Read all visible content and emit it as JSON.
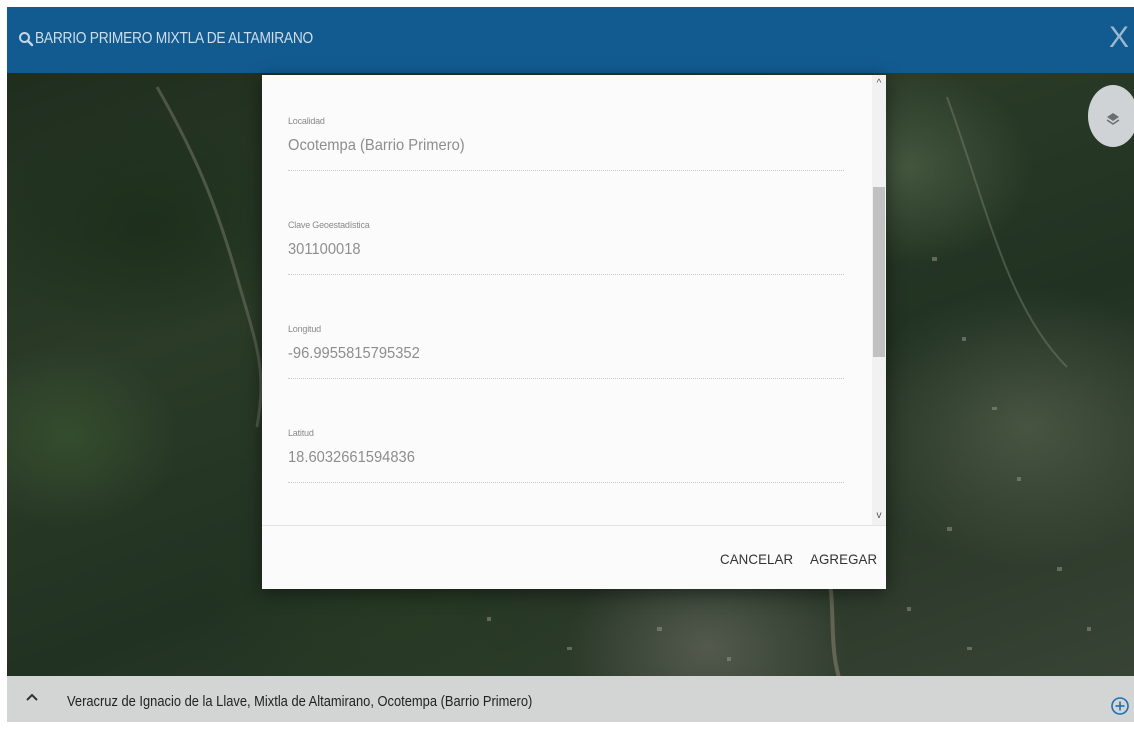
{
  "search": {
    "query": "BARRIO PRIMERO MIXTLA DE ALTAMIRANO",
    "close_label": "X"
  },
  "icons": {
    "search": "search-icon",
    "close": "close-icon",
    "layers": "layers-icon",
    "scroll_up": "chevron-up-icon",
    "scroll_down": "chevron-down-icon",
    "expand": "chevron-up-icon",
    "add_location": "add-circle-icon"
  },
  "dialog": {
    "fields": [
      {
        "label": "Localidad",
        "value": "Ocotempa (Barrio Primero)"
      },
      {
        "label": "Clave Geoestadística",
        "value": "301100018"
      },
      {
        "label": "Longitud",
        "value": "-96.9955815795352"
      },
      {
        "label": "Latitud",
        "value": "18.6032661594836"
      }
    ],
    "cancel_label": "CANCELAR",
    "add_label": "AGREGAR",
    "scroll_up_glyph": "^",
    "scroll_down_glyph": "v"
  },
  "bottom_bar": {
    "location_path": "Veracruz de Ignacio de la Llave, Mixtla de Altamirano, Ocotempa (Barrio Primero)"
  },
  "colors": {
    "topbar": "#125b91",
    "bottombar": "#d3d4d4",
    "accent": "#1e6fb8"
  }
}
